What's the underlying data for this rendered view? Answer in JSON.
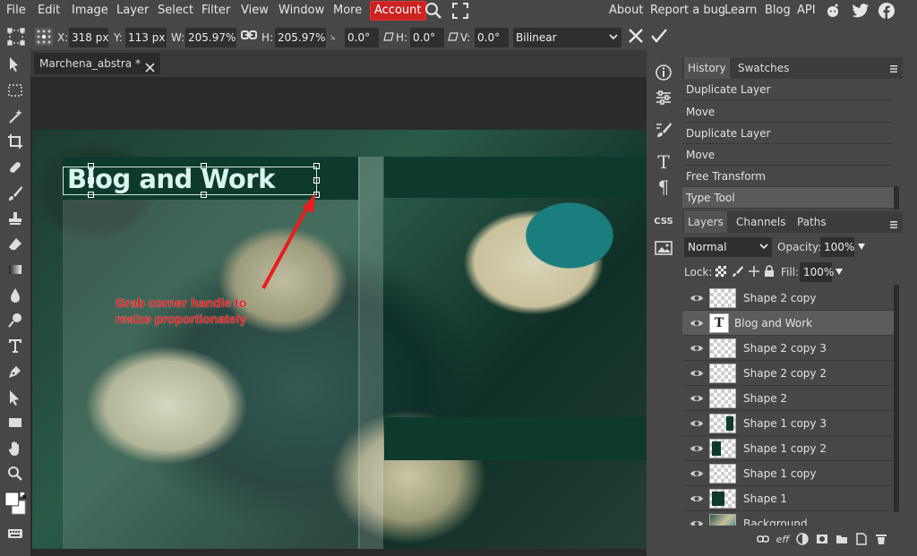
{
  "menu": {
    "items": [
      "File",
      "Edit",
      "Image",
      "Layer",
      "Select",
      "Filter",
      "View",
      "Window",
      "More"
    ],
    "account": "Account",
    "right": [
      "About",
      "Report a bug",
      "Learn",
      "Blog",
      "API"
    ]
  },
  "options": {
    "x_label": "X:",
    "x_value": "318 px",
    "y_label": "Y:",
    "y_value": "113 px",
    "w_label": "W:",
    "w_value": "205.97%",
    "h_label": "H:",
    "h_value": "205.97%",
    "angle_value": "0.0°",
    "h_skew_label": "H:",
    "h_skew_value": "0.0°",
    "v_skew_label": "V:",
    "v_skew_value": "0.0°",
    "interpolation": "Bilinear"
  },
  "document": {
    "tab_title": "Marchena_abstra *",
    "canvas_text": "Blog and Work",
    "annotation": "Grab corner handle to\nresize proportionately"
  },
  "history_panel": {
    "tabs": [
      "History",
      "Swatches"
    ],
    "items": [
      "Duplicate Layer",
      "Move",
      "Duplicate Layer",
      "Move",
      "Free Transform",
      "Type Tool"
    ]
  },
  "layers_panel": {
    "tabs": [
      "Layers",
      "Channels",
      "Paths"
    ],
    "blend_mode": "Normal",
    "opacity_label": "Opacity:",
    "opacity_value": "100%",
    "lock_label": "Lock:",
    "fill_label": "Fill:",
    "fill_value": "100%",
    "layers": [
      "Shape 2 copy",
      "Blog and Work",
      "Shape 2 copy 3",
      "Shape 2 copy 2",
      "Shape 2",
      "Shape 1 copy 3",
      "Shape 1 copy 2",
      "Shape 1 copy",
      "Shape 1",
      "Background"
    ],
    "selected": "Blog and Work"
  },
  "sidebar": {
    "css_label": "CSS"
  },
  "colors": {
    "accent": "#cc2222",
    "annotation": "#e81d1d",
    "canvas_text": "#d9f5ec",
    "band": "#0e3a2e"
  }
}
